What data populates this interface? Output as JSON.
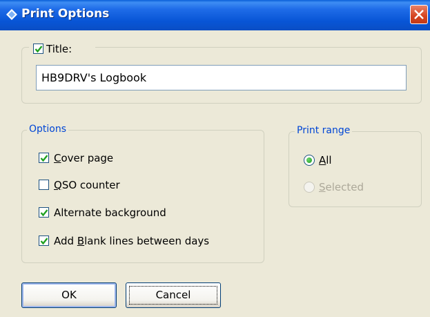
{
  "window": {
    "title": "Print Options",
    "icon": "diamond-app-icon",
    "close_icon": "close-icon"
  },
  "title_group": {
    "checkbox_label": "Title:",
    "checked": true,
    "value": "HB9DRV's Logbook"
  },
  "options": {
    "label": "Options",
    "items": [
      {
        "pre": "",
        "ul": "C",
        "post": "over page",
        "checked": true
      },
      {
        "pre": "",
        "ul": "Q",
        "post": "SO counter",
        "checked": false
      },
      {
        "pre": "Alternate background",
        "ul": "",
        "post": "",
        "checked": true
      },
      {
        "pre": "Add ",
        "ul": "B",
        "post": "lank lines between days",
        "checked": true
      }
    ]
  },
  "print_range": {
    "label": "Print range",
    "all": {
      "ul": "A",
      "post": "ll",
      "selected": true,
      "enabled": true
    },
    "selected": {
      "ul": "S",
      "post": "elected",
      "selected": false,
      "enabled": false
    }
  },
  "buttons": {
    "ok": "OK",
    "cancel": "Cancel"
  },
  "colors": {
    "titlebar": "#0a5fd8",
    "group_label": "#0046d5",
    "disabled_text": "#aca899",
    "face": "#ece9d8"
  }
}
